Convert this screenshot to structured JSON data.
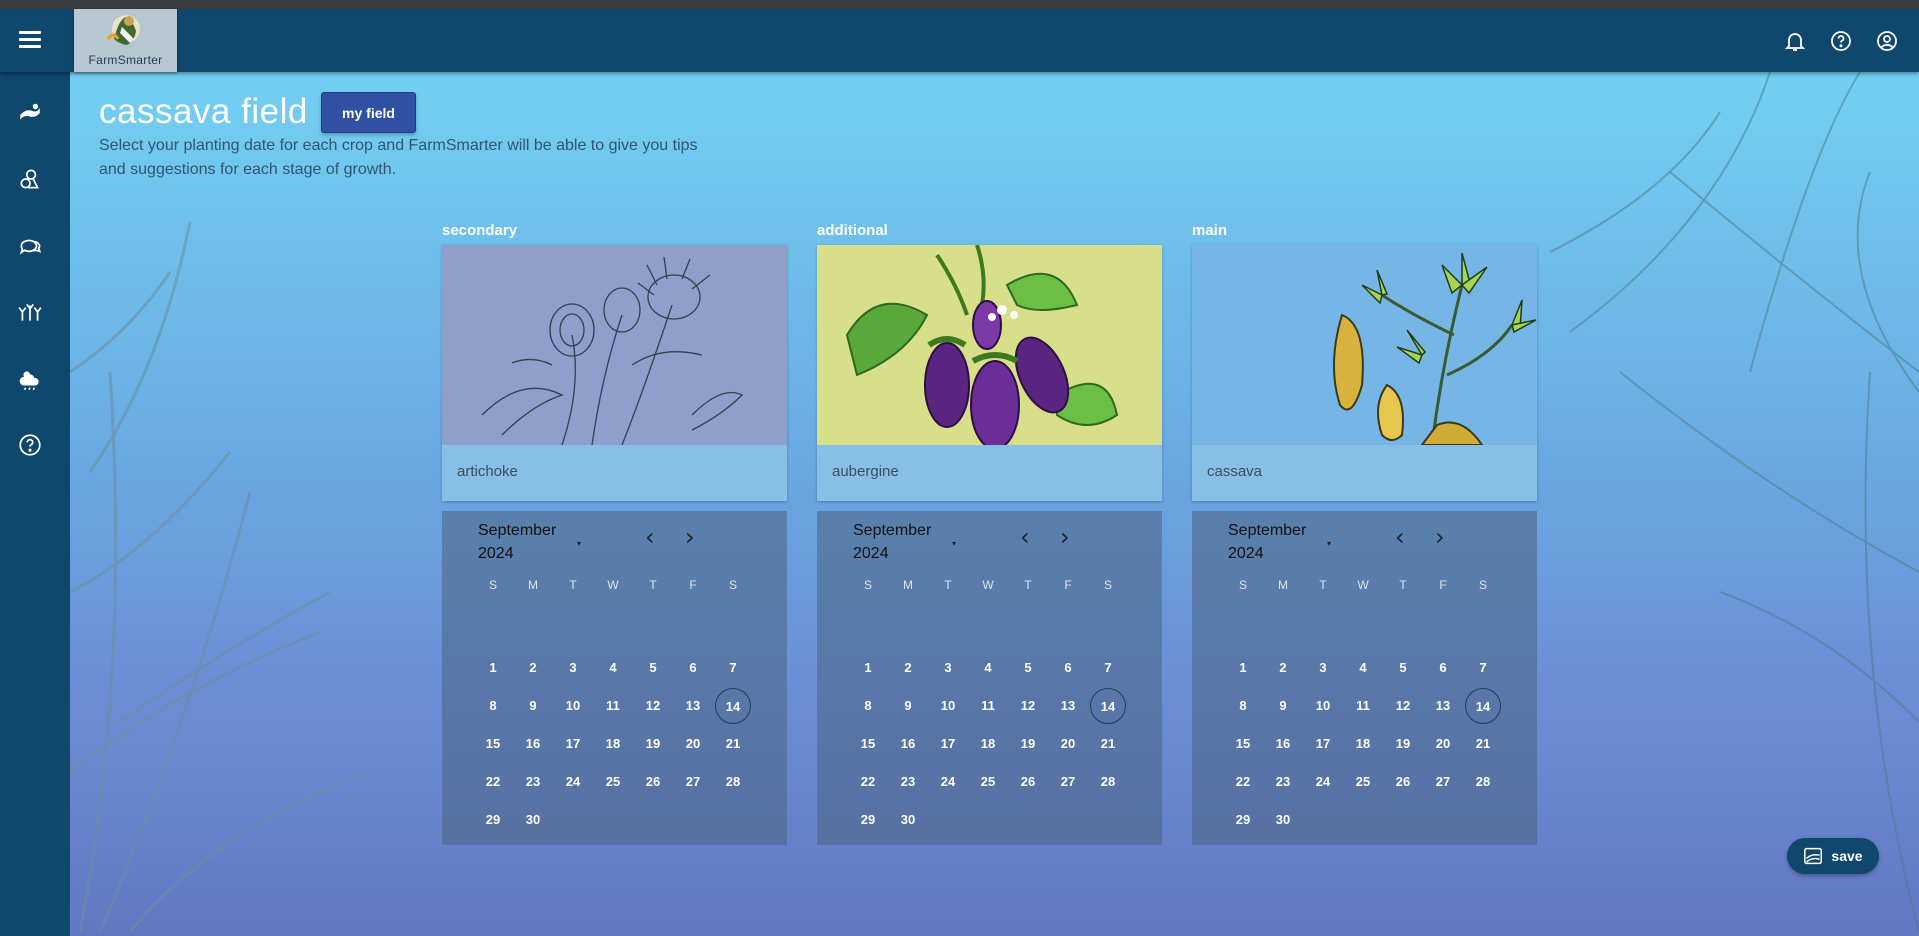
{
  "app": {
    "logo_text": "FarmSmarter"
  },
  "sidebar": {
    "items": [
      {
        "icon": "field-icon"
      },
      {
        "icon": "crops-icon"
      },
      {
        "icon": "chat-icon"
      },
      {
        "icon": "plants-icon"
      },
      {
        "icon": "weather-icon"
      },
      {
        "icon": "help-icon"
      }
    ]
  },
  "header": {
    "icons": [
      "bell-icon",
      "help-icon",
      "account-icon"
    ]
  },
  "page": {
    "title": "cassava field",
    "my_field_label": "my field",
    "subtitle": "Select your planting date for each crop and FarmSmarter will be able to give you tips and suggestions for each stage of growth."
  },
  "crops": [
    {
      "role": "secondary",
      "name": "artichoke",
      "month": "September",
      "year": "2024",
      "selected_day": 14,
      "image_bg": "#8d9fca"
    },
    {
      "role": "additional",
      "name": "aubergine",
      "month": "September",
      "year": "2024",
      "selected_day": 14,
      "image_bg": "#d8df8a"
    },
    {
      "role": "main",
      "name": "cassava",
      "month": "September",
      "year": "2024",
      "selected_day": 14,
      "image_bg": "#76b6e6"
    }
  ],
  "calendar": {
    "weekdays": [
      "S",
      "M",
      "T",
      "W",
      "T",
      "F",
      "S"
    ],
    "first_weekday_offset": 0,
    "days_in_month": 30,
    "prev_glyph": "‹",
    "next_glyph": "›",
    "dropdown_glyph": "▾"
  },
  "save_label": "save",
  "colors": {
    "nav": "#10476d",
    "button": "#3050a3"
  }
}
